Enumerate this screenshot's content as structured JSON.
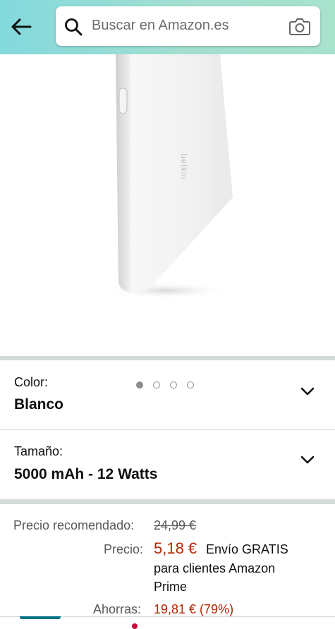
{
  "header": {
    "search_placeholder": "Buscar en Amazon.es",
    "colors": {
      "gradient_start": "#83d9dd",
      "gradient_end": "#a8e2cd"
    }
  },
  "gallery": {
    "image_count": 4,
    "active_index": 0,
    "product_image": "white-power-bank"
  },
  "options": {
    "color": {
      "label": "Color:",
      "value": "Blanco"
    },
    "size": {
      "label": "Tamaño:",
      "value": "5000 mAh - 12 Watts"
    }
  },
  "pricing": {
    "rrp_label": "Precio recomendado:",
    "rrp_value": "24,99 €",
    "price_label": "Precio:",
    "price_value": "5,18 €",
    "shipping_line1": "Envío GRATIS",
    "shipping_line2": "para clientes Amazon",
    "shipping_line3": "Prime",
    "savings_label": "Ahorras:",
    "savings_value": "19,81 € (79%)"
  },
  "colors": {
    "price": "#b12704",
    "accent": "#007185"
  }
}
